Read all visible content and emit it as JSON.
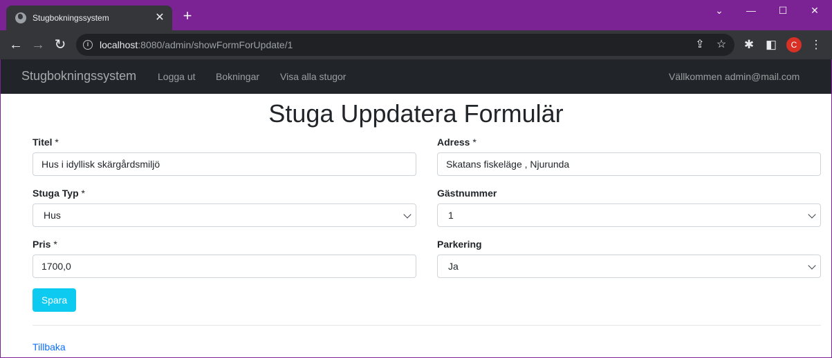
{
  "browser": {
    "tab_title": "Stugbokningssystem",
    "tab_close": "✕",
    "new_tab": "+",
    "window": {
      "minimize": "—",
      "maximize": "☐",
      "close": "✕",
      "tab_list": "⌄"
    },
    "url_host": "localhost",
    "url_rest": ":8080/admin/showFormForUpdate/1",
    "profile_initial": "C",
    "icons": [
      "back-icon",
      "forward-icon",
      "reload-icon",
      "info-icon",
      "share-icon",
      "star-icon",
      "extensions-icon",
      "sidebar-icon",
      "profile-avatar",
      "menu-icon"
    ]
  },
  "navbar": {
    "brand": "Stugbokningssystem",
    "links": [
      "Logga ut",
      "Bokningar",
      "Visa alla stugor"
    ],
    "welcome": "Vällkommen admin@mail.com"
  },
  "form": {
    "title": "Stuga Uppdatera Formulär",
    "fields": {
      "titel": {
        "label": "Titel",
        "required": "*",
        "value": "Hus i idyllisk skärgårdsmiljö"
      },
      "adress": {
        "label": "Adress",
        "required": "*",
        "value": "Skatans fiskeläge , Njurunda"
      },
      "typ": {
        "label": "Stuga Typ",
        "required": "*",
        "value": "Hus"
      },
      "gastnummer": {
        "label": "Gästnummer",
        "value": "1"
      },
      "pris": {
        "label": "Pris",
        "required": "*",
        "value": "1700,0"
      },
      "parkering": {
        "label": "Parkering",
        "value": "Ja"
      }
    },
    "save": "Spara",
    "back": "Tillbaka"
  },
  "colors": {
    "tabbar": "#7b2394",
    "navbar": "#212529",
    "save_button": "#0dcaf0",
    "link": "#0d6efd"
  }
}
